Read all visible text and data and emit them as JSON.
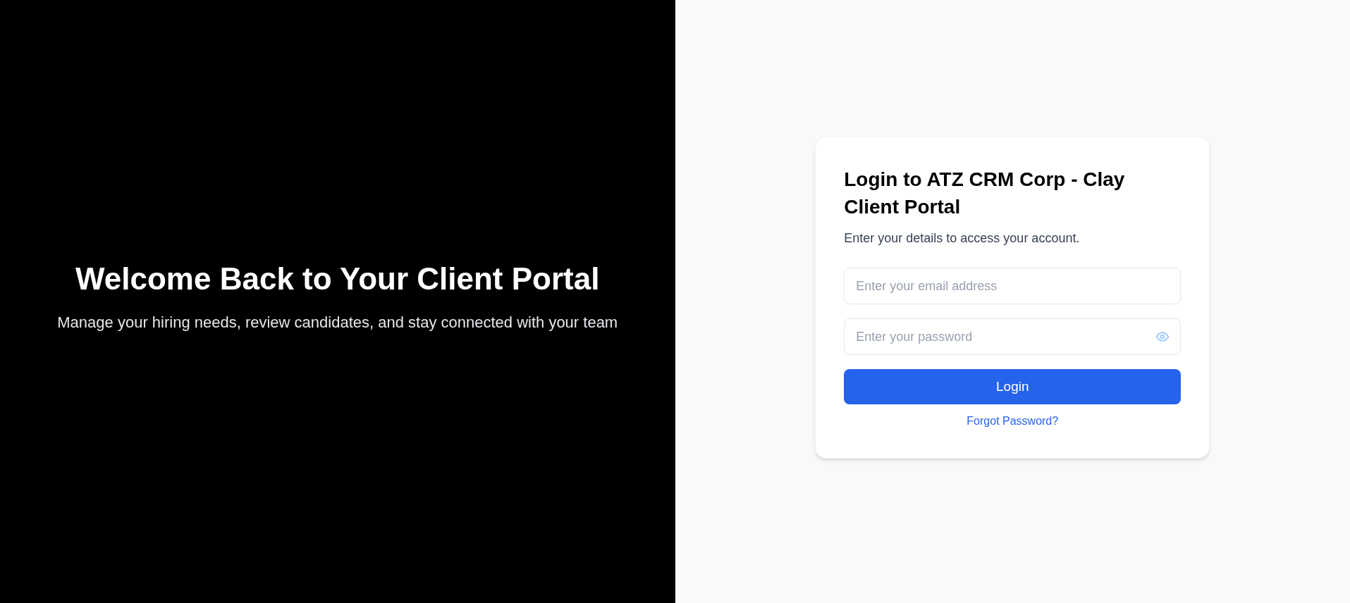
{
  "hero": {
    "title": "Welcome Back to Your Client Portal",
    "subtitle": "Manage your hiring needs, review candidates, and stay connected with your team"
  },
  "login_card": {
    "title": "Login to ATZ CRM Corp - Clay Client Portal",
    "subtitle": "Enter your details to access your account.",
    "email": {
      "placeholder": "Enter your email address"
    },
    "password": {
      "placeholder": "Enter your password"
    },
    "button": "Login",
    "link": "Forgot Password?"
  }
}
